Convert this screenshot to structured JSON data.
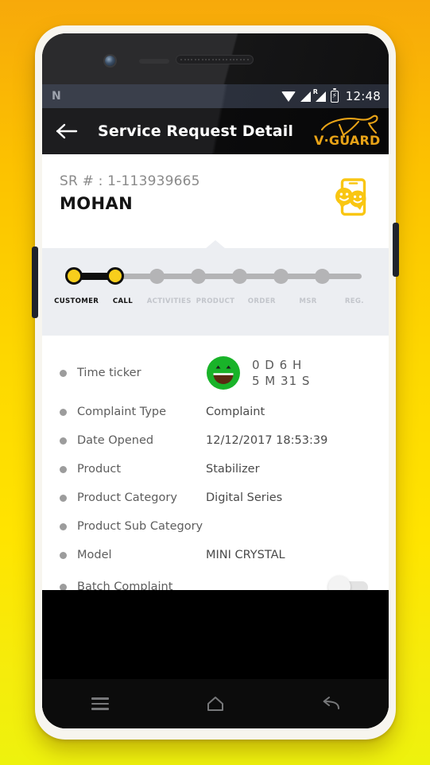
{
  "device": {
    "statusbar": {
      "left_logo": "N",
      "clock": "12:48",
      "icons": [
        "wifi-icon",
        "signal-icon",
        "roaming-signal-icon",
        "battery-charging-icon"
      ]
    },
    "navbar": {
      "menu_label": "menu-icon",
      "home_label": "home-icon",
      "back_label": "back-icon"
    }
  },
  "appbar": {
    "back_icon": "back-arrow-icon",
    "title": "Service Request Detail",
    "brand": "V·GUARD",
    "brand_color": "#e8a317"
  },
  "sr_header": {
    "number": "SR # : 1-113939665",
    "name": "MOHAN",
    "icon": "phone-chat-smileys-icon",
    "icon_color": "#f9c612"
  },
  "stepper": {
    "active_color": "#f8ce1c",
    "done_color": "#0e0e0e",
    "pending_color": "#b4b4b6",
    "steps": [
      {
        "label": "CUSTOMER",
        "state": "done"
      },
      {
        "label": "CALL",
        "state": "done"
      },
      {
        "label": "ACTIVITIES",
        "state": "pending"
      },
      {
        "label": "PRODUCT",
        "state": "pending"
      },
      {
        "label": "ORDER",
        "state": "pending"
      },
      {
        "label": "MSR",
        "state": "pending"
      },
      {
        "label": "REG.",
        "state": "pending"
      }
    ]
  },
  "details": {
    "ticker": {
      "label": "Time ticker",
      "icon": "green-happy-smiley-icon",
      "icon_color": "#19b329",
      "line1": "0 D 6 H",
      "line2": "5 M 31 S"
    },
    "rows": [
      {
        "label": "Complaint Type",
        "value": "Complaint"
      },
      {
        "label": "Date Opened",
        "value": "12/12/2017 18:53:39"
      },
      {
        "label": "Product",
        "value": "Stabilizer"
      },
      {
        "label": "Product Category",
        "value": "Digital Series"
      },
      {
        "label": "Product Sub Category",
        "value": ""
      },
      {
        "label": "Model",
        "value": "MINI CRYSTAL"
      }
    ],
    "batch": {
      "label": "Batch Complaint",
      "toggle_state": "off"
    }
  }
}
